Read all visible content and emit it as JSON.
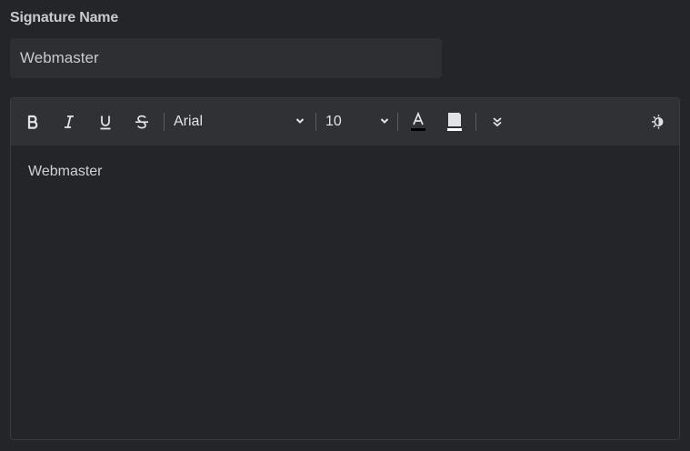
{
  "form": {
    "signature_name_label": "Signature Name",
    "signature_name_value": "Webmaster"
  },
  "toolbar": {
    "font_family": "Arial",
    "font_size": "10",
    "icons": [
      "bold-icon",
      "italic-icon",
      "underline-icon",
      "strikethrough-icon",
      "chevron-down-icon",
      "text-color-icon",
      "highlight-color-icon",
      "more-options-icon",
      "theme-toggle-icon"
    ],
    "text_color": "#000000",
    "highlight_color": "#ffffff"
  },
  "editor": {
    "content": "Webmaster"
  },
  "colors": {
    "background": "#242528",
    "toolbar_bg": "#303135",
    "input_bg": "#2e2f33",
    "icon": "#e2e3e6"
  }
}
